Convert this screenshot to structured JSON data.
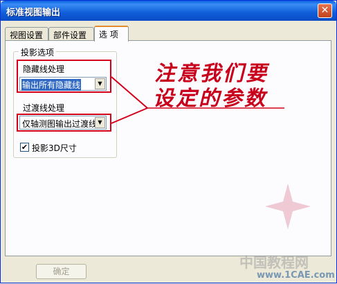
{
  "window": {
    "title": "标准视图输出",
    "close_glyph": "✕"
  },
  "tabs": [
    {
      "label": "视图设置",
      "active": false
    },
    {
      "label": "部件设置",
      "active": false
    },
    {
      "label": "选 项",
      "active": true
    }
  ],
  "group": {
    "title": "投影选项"
  },
  "hidden_lines": {
    "label": "隐藏线处理",
    "value": "输出所有隐藏线"
  },
  "transition_lines": {
    "label": "过渡线处理",
    "value": "仅轴测图输出过渡线"
  },
  "checkbox_3d": {
    "label": "投影3D尺寸",
    "checked": true,
    "mark": "✔"
  },
  "annotation": {
    "line1": "注意我们要",
    "line2": "设定的参数"
  },
  "ok_button": {
    "label": "确定"
  },
  "watermark": {
    "line1": "中国教程网",
    "line2": "www.1CAE.com"
  },
  "colors": {
    "title_bar": "#0a5fe0",
    "annotation": "#c8001c",
    "selection": "#316ac5",
    "tab_accent": "#e68b2c"
  }
}
